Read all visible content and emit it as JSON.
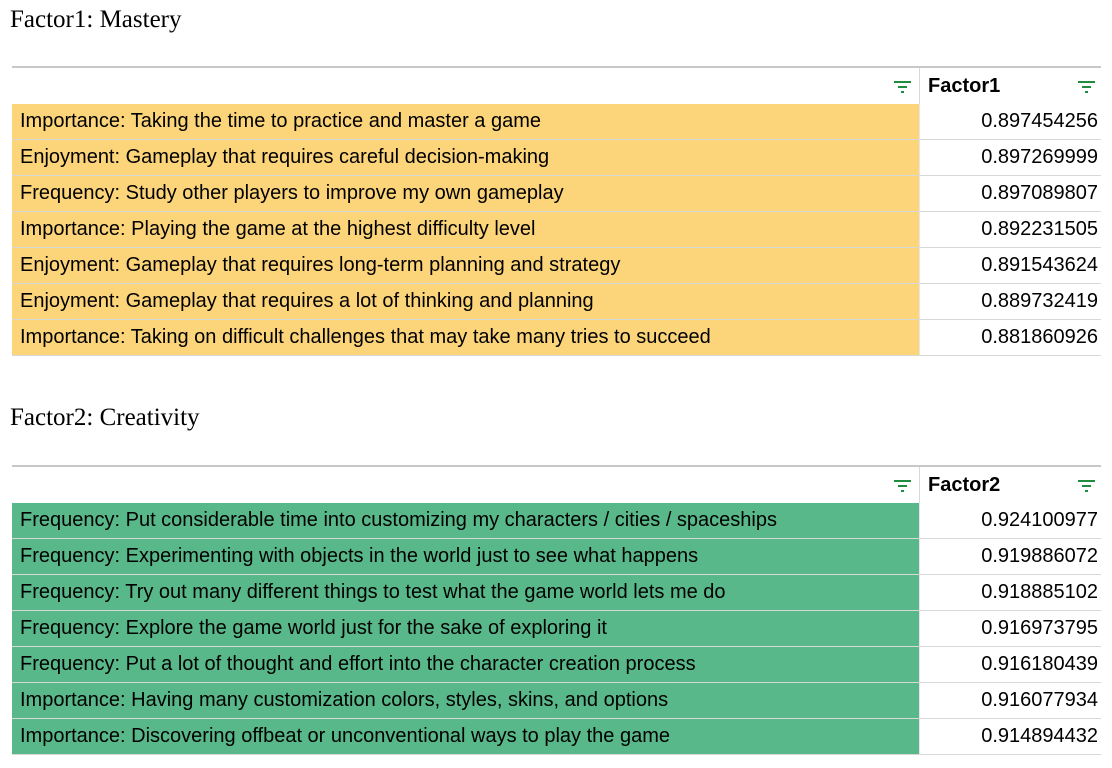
{
  "sections": [
    {
      "title": "Factor1: Mastery",
      "header": {
        "label": "",
        "value": "Factor1"
      },
      "fill_color": "#fcd57a",
      "rows": [
        {
          "label": "Importance: Taking the time to practice and master a game",
          "value": "0.897454256"
        },
        {
          "label": "Enjoyment: Gameplay that requires careful decision-making",
          "value": "0.897269999"
        },
        {
          "label": "Frequency: Study other players to improve my own gameplay",
          "value": "0.897089807"
        },
        {
          "label": "Importance: Playing the game at the highest difficulty level",
          "value": "0.892231505"
        },
        {
          "label": "Enjoyment: Gameplay that requires long-term planning and strategy",
          "value": "0.891543624"
        },
        {
          "label": "Enjoyment: Gameplay that requires a lot of thinking and planning",
          "value": "0.889732419"
        },
        {
          "label": "Importance: Taking on difficult challenges that may take many tries to succeed",
          "value": "0.881860926"
        }
      ]
    },
    {
      "title": "Factor2: Creativity",
      "header": {
        "label": "",
        "value": "Factor2"
      },
      "fill_color": "#58b889",
      "rows": [
        {
          "label": "Frequency: Put considerable time into customizing my characters / cities / spaceships",
          "value": "0.924100977"
        },
        {
          "label": "Frequency: Experimenting with objects in the world just to see what happens",
          "value": "0.919886072"
        },
        {
          "label": "Frequency: Try out many different things to test what the game world lets me do",
          "value": "0.918885102"
        },
        {
          "label": "Frequency: Explore the game world just for the sake of exploring it",
          "value": "0.916973795"
        },
        {
          "label": "Frequency: Put a lot of thought and effort into the character creation process",
          "value": "0.916180439"
        },
        {
          "label": "Importance: Having many customization colors, styles, skins, and options",
          "value": "0.916077934"
        },
        {
          "label": "Importance: Discovering offbeat or unconventional ways to play the game",
          "value": "0.914894432"
        }
      ]
    }
  ],
  "icons": {
    "filter": "filter-icon"
  },
  "colors": {
    "filter_icon": "#1e8e3e",
    "mastery_fill": "#fcd57a",
    "creativity_fill": "#58b889"
  }
}
